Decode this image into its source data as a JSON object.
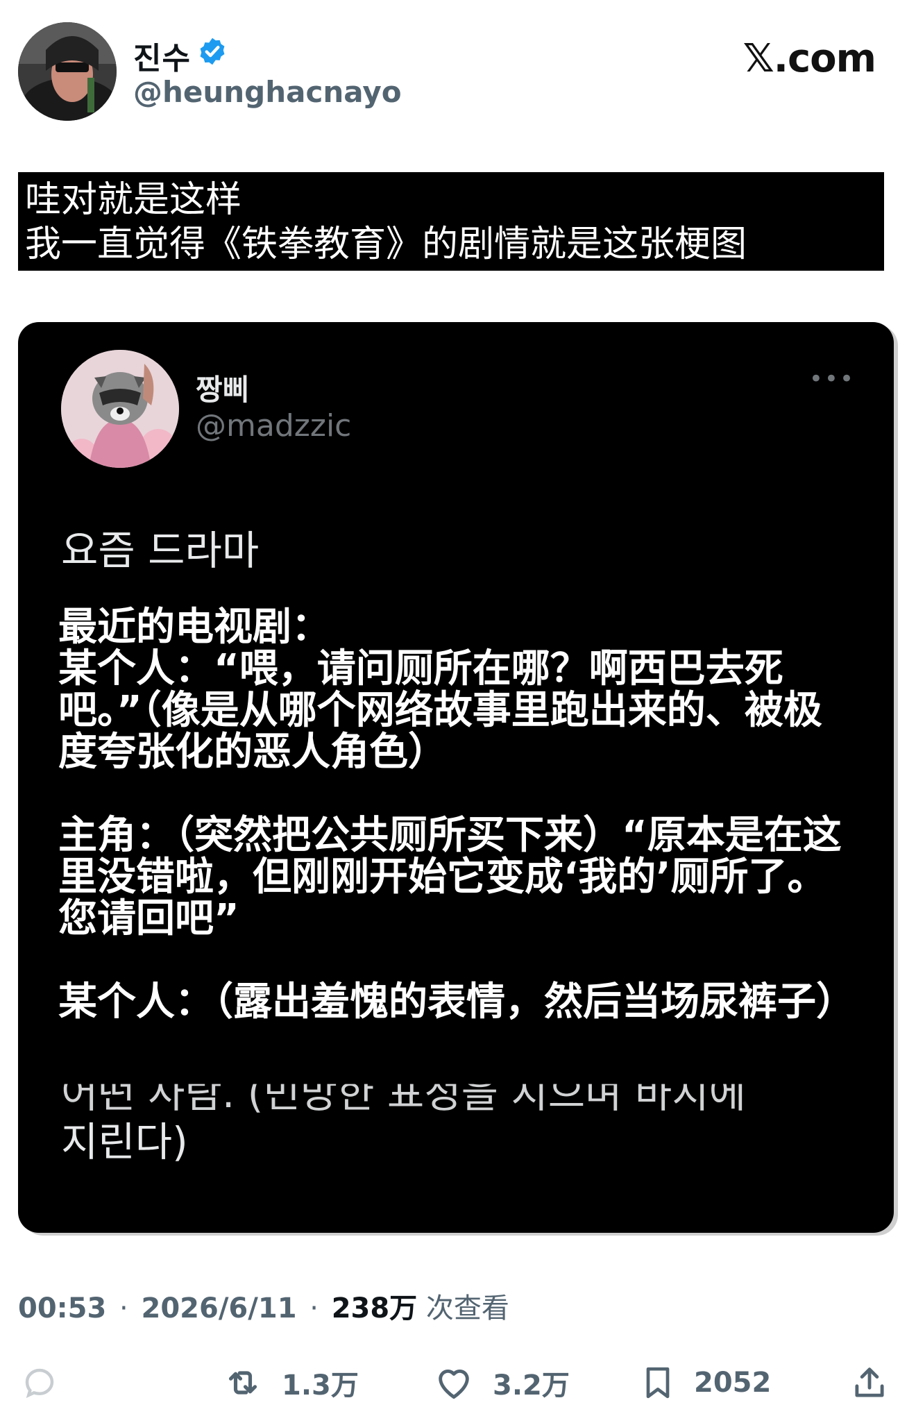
{
  "author": {
    "display_name": "진수",
    "handle": "@heunghacnayo",
    "verified": true,
    "verified_color": "#1d9bf0"
  },
  "brand": "𝕏.com",
  "caption": {
    "line1": "哇对就是这样",
    "line2": "我一直觉得《铁拳教育》的剧情就是这张梗图"
  },
  "quoted_post": {
    "display_name": "짱삐",
    "handle": "@madzzic",
    "more_icon": "more-horizontal-icon",
    "korean_line1": "요즘 드라마",
    "korean_partial": "어떤 사람. (민망한 표정을 지으며 바지에",
    "korean_line2": "지린다)",
    "translation": [
      "最近的电视剧：\n某个人：“喂，请问厕所在哪？啊西巴去死吧。”（像是从哪个网络故事里跑出来的、被极度夸张化的恶人角色）",
      "主角：（突然把公共厕所买下来）“原本是在这里没错啦，但刚刚开始它变成‘我的’厕所了。您请回吧”",
      "某个人：（露出羞愧的表情，然后当场尿裤子）"
    ]
  },
  "meta": {
    "time": "00:53",
    "separator": "·",
    "date": "2026/6/11",
    "views_count": "238万",
    "views_label": "次查看"
  },
  "actions": {
    "reply": {
      "icon": "reply-icon",
      "count": ""
    },
    "retweet": {
      "icon": "retweet-icon",
      "count": "1.3万"
    },
    "like": {
      "icon": "heart-icon",
      "count": "3.2万"
    },
    "bookmark": {
      "icon": "bookmark-icon",
      "count": "2052"
    },
    "share": {
      "icon": "share-icon",
      "count": ""
    }
  }
}
